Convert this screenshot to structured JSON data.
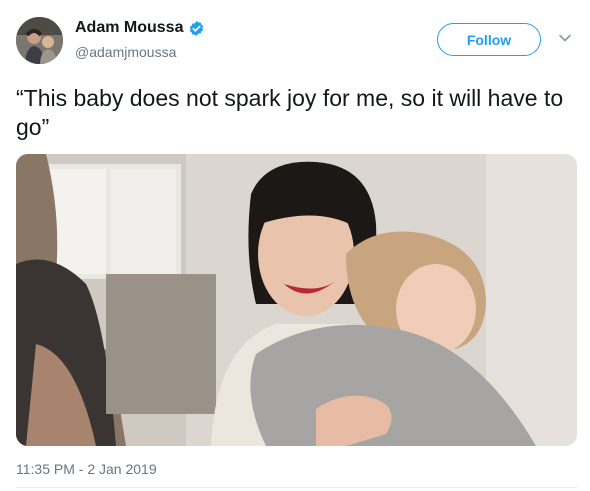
{
  "author": {
    "name": "Adam Moussa",
    "handle": "@adamjmoussa",
    "verified": true
  },
  "follow_label": "Follow",
  "icons": {
    "avatar": "avatar-photo",
    "verified": "verified-badge-icon",
    "menu": "chevron-down-icon"
  },
  "tweet": {
    "text": "“This baby does not spark joy for me, so it will have to go”",
    "timestamp": "11:35 PM - 2 Jan 2019"
  },
  "colors": {
    "accent": "#1da1f2",
    "secondary_text": "#657786",
    "primary_text": "#14171a"
  }
}
